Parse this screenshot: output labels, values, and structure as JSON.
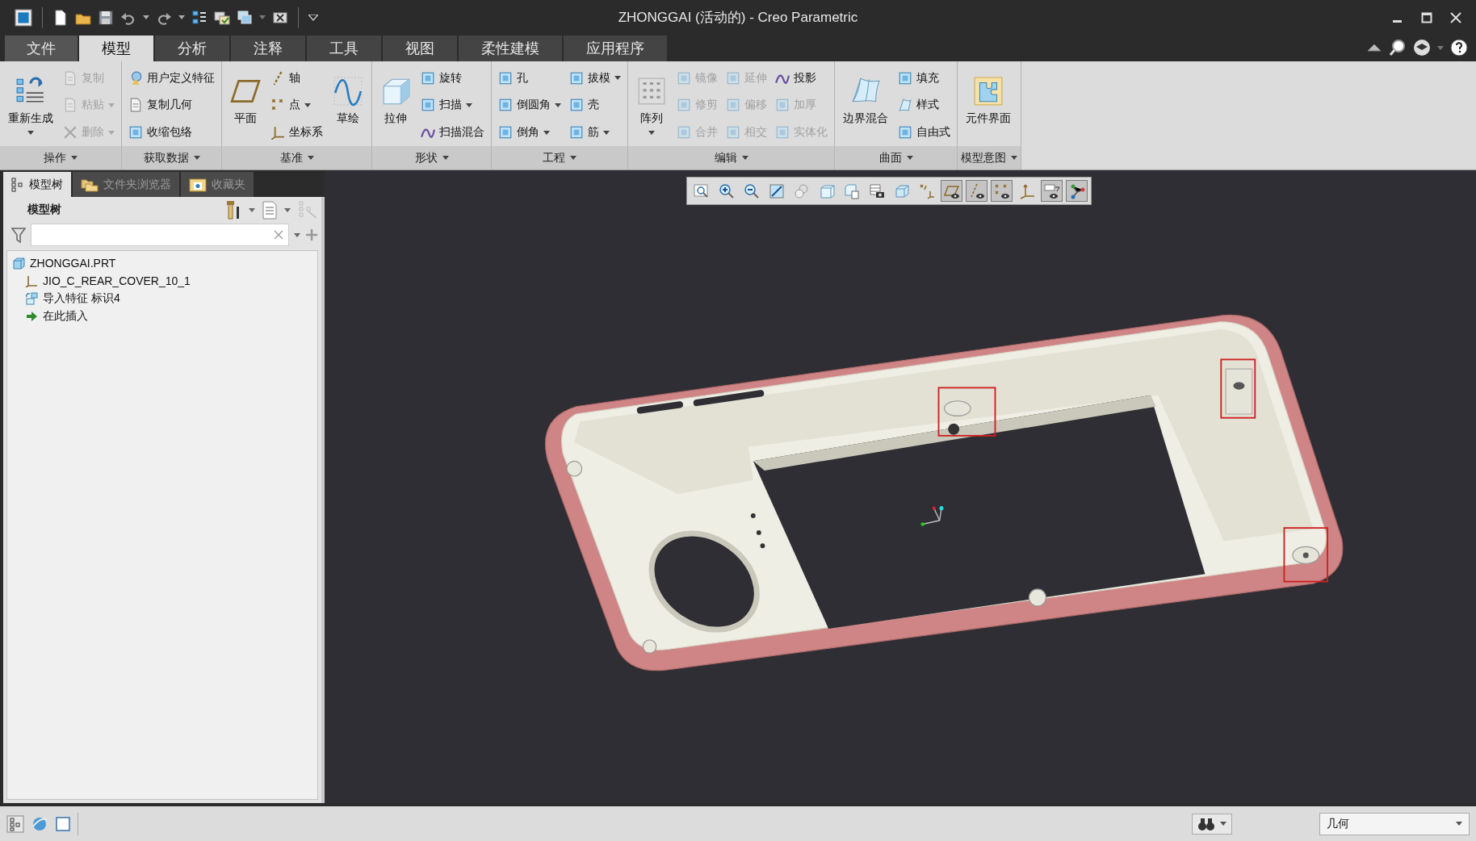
{
  "window": {
    "title": "ZHONGGAI (活动的) - Creo Parametric"
  },
  "ribbon_tabs": [
    {
      "label": "文件",
      "kind": "file",
      "selected": false
    },
    {
      "label": "模型",
      "kind": "tab",
      "selected": true
    },
    {
      "label": "分析",
      "kind": "tab",
      "selected": false
    },
    {
      "label": "注释",
      "kind": "tab",
      "selected": false
    },
    {
      "label": "工具",
      "kind": "tab",
      "selected": false
    },
    {
      "label": "视图",
      "kind": "tab",
      "selected": false
    },
    {
      "label": "柔性建模",
      "kind": "tab",
      "selected": false
    },
    {
      "label": "应用程序",
      "kind": "tab",
      "selected": false
    }
  ],
  "ribbon_groups": [
    {
      "label": "操作",
      "columns": [
        [
          {
            "label": "重新生成",
            "kind": "large",
            "dropdown": true,
            "disabled": false
          }
        ],
        [
          {
            "label": "复制",
            "kind": "small",
            "dropdown": false,
            "disabled": true
          },
          {
            "label": "粘贴",
            "kind": "small",
            "dropdown": true,
            "disabled": true
          },
          {
            "label": "删除",
            "kind": "small",
            "dropdown": true,
            "disabled": true
          }
        ]
      ]
    },
    {
      "label": "获取数据",
      "columns": [
        [
          {
            "label": "用户定义特征",
            "kind": "small",
            "dropdown": false,
            "disabled": false
          },
          {
            "label": "复制几何",
            "kind": "small",
            "dropdown": false,
            "disabled": false
          },
          {
            "label": "收缩包络",
            "kind": "small",
            "dropdown": false,
            "disabled": false
          }
        ]
      ]
    },
    {
      "label": "基准",
      "columns": [
        [
          {
            "label": "平面",
            "kind": "large",
            "dropdown": false,
            "disabled": false
          }
        ],
        [
          {
            "label": "轴",
            "kind": "small",
            "dropdown": false,
            "disabled": false
          },
          {
            "label": "点",
            "kind": "small",
            "dropdown": true,
            "disabled": false
          },
          {
            "label": "坐标系",
            "kind": "small",
            "dropdown": false,
            "disabled": false
          }
        ],
        [
          {
            "label": "草绘",
            "kind": "large",
            "dropdown": false,
            "disabled": false
          }
        ]
      ]
    },
    {
      "label": "形状",
      "columns": [
        [
          {
            "label": "拉伸",
            "kind": "large",
            "dropdown": false,
            "disabled": false
          }
        ],
        [
          {
            "label": "旋转",
            "kind": "small",
            "dropdown": false,
            "disabled": false
          },
          {
            "label": "扫描",
            "kind": "small",
            "dropdown": true,
            "disabled": false
          },
          {
            "label": "扫描混合",
            "kind": "small",
            "dropdown": false,
            "disabled": false
          }
        ]
      ]
    },
    {
      "label": "工程",
      "columns": [
        [
          {
            "label": "孔",
            "kind": "small",
            "dropdown": false,
            "disabled": false
          },
          {
            "label": "倒圆角",
            "kind": "small",
            "dropdown": true,
            "disabled": false
          },
          {
            "label": "倒角",
            "kind": "small",
            "dropdown": true,
            "disabled": false
          }
        ],
        [
          {
            "label": "拔模",
            "kind": "small",
            "dropdown": true,
            "disabled": false
          },
          {
            "label": "壳",
            "kind": "small",
            "dropdown": false,
            "disabled": false
          },
          {
            "label": "筋",
            "kind": "small",
            "dropdown": true,
            "disabled": false
          }
        ]
      ]
    },
    {
      "label": "编辑",
      "columns": [
        [
          {
            "label": "阵列",
            "kind": "large",
            "dropdown": true,
            "disabled": false
          }
        ],
        [
          {
            "label": "镜像",
            "kind": "small",
            "dropdown": false,
            "disabled": true
          },
          {
            "label": "修剪",
            "kind": "small",
            "dropdown": false,
            "disabled": true
          },
          {
            "label": "合并",
            "kind": "small",
            "dropdown": false,
            "disabled": true
          }
        ],
        [
          {
            "label": "延伸",
            "kind": "small",
            "dropdown": false,
            "disabled": true
          },
          {
            "label": "偏移",
            "kind": "small",
            "dropdown": false,
            "disabled": true
          },
          {
            "label": "相交",
            "kind": "small",
            "dropdown": false,
            "disabled": true
          }
        ],
        [
          {
            "label": "投影",
            "kind": "small",
            "dropdown": false,
            "disabled": false
          },
          {
            "label": "加厚",
            "kind": "small",
            "dropdown": false,
            "disabled": true
          },
          {
            "label": "实体化",
            "kind": "small",
            "dropdown": false,
            "disabled": true
          }
        ]
      ]
    },
    {
      "label": "曲面",
      "columns": [
        [
          {
            "label": "边界混合",
            "kind": "large",
            "dropdown": false,
            "disabled": false
          }
        ],
        [
          {
            "label": "填充",
            "kind": "small",
            "dropdown": false,
            "disabled": false
          },
          {
            "label": "样式",
            "kind": "small",
            "dropdown": false,
            "disabled": false
          },
          {
            "label": "自由式",
            "kind": "small",
            "dropdown": false,
            "disabled": false
          }
        ]
      ]
    },
    {
      "label": "模型意图",
      "columns": [
        [
          {
            "label": "元件界面",
            "kind": "large",
            "dropdown": false,
            "disabled": false
          }
        ]
      ]
    }
  ],
  "panel_tabs": [
    {
      "label": "模型树",
      "selected": true
    },
    {
      "label": "文件夹浏览器",
      "selected": false
    },
    {
      "label": "收藏夹",
      "selected": false
    }
  ],
  "model_tree": {
    "header": "模型树",
    "items": [
      {
        "label": "ZHONGGAI.PRT",
        "children": [
          {
            "label": "JIO_C_REAR_COVER_10_1"
          },
          {
            "label": "导入特征 标识4"
          },
          {
            "label": "在此插入"
          }
        ]
      }
    ]
  },
  "view_toolbar": [
    {
      "on": false
    },
    {
      "on": false
    },
    {
      "on": false
    },
    {
      "on": false
    },
    {
      "on": false
    },
    {
      "on": false
    },
    {
      "on": false
    },
    {
      "on": false
    },
    {
      "on": false
    },
    {
      "on": false
    },
    {
      "on": true
    },
    {
      "on": true
    },
    {
      "on": true
    },
    {
      "on": false
    },
    {
      "on": true
    },
    {
      "on": true
    }
  ],
  "status_bar": {
    "selection_filter": "几何"
  }
}
